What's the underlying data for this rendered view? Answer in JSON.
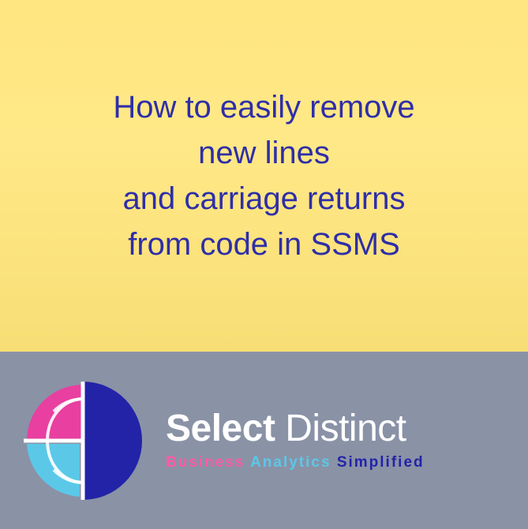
{
  "headline": {
    "line1": "How to easily remove",
    "line2": "new lines",
    "line3": "and carriage returns",
    "line4": "from code in SSMS"
  },
  "brand": {
    "name_bold": "Select",
    "name_light": "Distinct",
    "tagline_part1": "Business",
    "tagline_part2": "Analytics",
    "tagline_part3": "Simplified"
  },
  "colors": {
    "headline": "#2e2ea8",
    "bg_top": "#f8e07a",
    "bg_bottom": "#8a92a6",
    "logo_pink": "#e83fa0",
    "logo_blue_dark": "#2323a8",
    "logo_blue_light": "#5bc8e8",
    "logo_blue_med": "#4a7dd4"
  }
}
